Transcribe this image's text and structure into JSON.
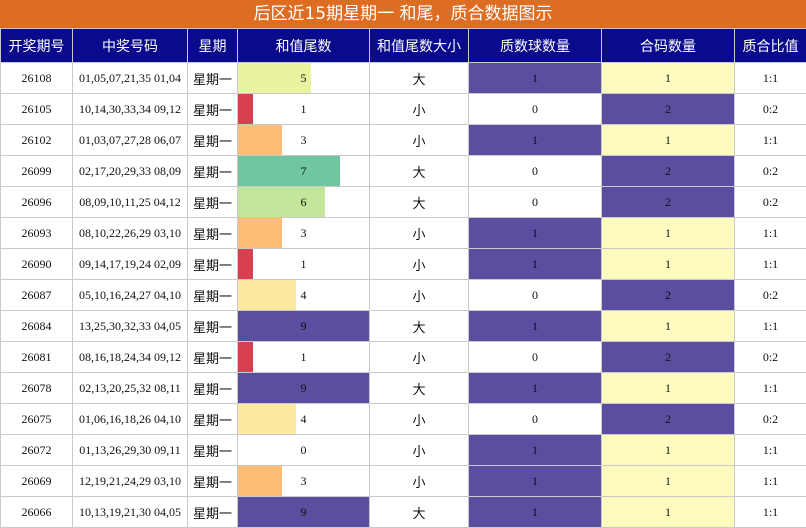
{
  "title": "后区近15期星期一 和尾，质合数据图示",
  "headers": [
    "开奖期号",
    "中奖号码",
    "星期",
    "和值尾数",
    "和值尾数大小",
    "质数球数量",
    "合码数量",
    "质合比值"
  ],
  "colors": {
    "title_bg": "#de6d24",
    "header_bg": "#0a0a8c",
    "purple": "#5b4da0",
    "light_yellow": "#fefbbf",
    "tail_colors": {
      "0": "#ffffff",
      "1": "#d9404f",
      "3": "#fdbd74",
      "4": "#fde9a0",
      "5": "#eaf4a0",
      "6": "#c3e69a",
      "7": "#6fc69f",
      "9": "#5b4da0"
    }
  },
  "rows": [
    {
      "issue": "26108",
      "numbers": "01,05,07,21,35 01,04",
      "weekday": "星期一",
      "tail": 5,
      "size": "大",
      "prime_count": 1,
      "composite_count": 1,
      "ratio": "1:1"
    },
    {
      "issue": "26105",
      "numbers": "10,14,30,33,34 09,12",
      "weekday": "星期一",
      "tail": 1,
      "size": "小",
      "prime_count": 0,
      "composite_count": 2,
      "ratio": "0:2"
    },
    {
      "issue": "26102",
      "numbers": "01,03,07,27,28 06,07",
      "weekday": "星期一",
      "tail": 3,
      "size": "小",
      "prime_count": 1,
      "composite_count": 1,
      "ratio": "1:1"
    },
    {
      "issue": "26099",
      "numbers": "02,17,20,29,33 08,09",
      "weekday": "星期一",
      "tail": 7,
      "size": "大",
      "prime_count": 0,
      "composite_count": 2,
      "ratio": "0:2"
    },
    {
      "issue": "26096",
      "numbers": "08,09,10,11,25 04,12",
      "weekday": "星期一",
      "tail": 6,
      "size": "大",
      "prime_count": 0,
      "composite_count": 2,
      "ratio": "0:2"
    },
    {
      "issue": "26093",
      "numbers": "08,10,22,26,29 03,10",
      "weekday": "星期一",
      "tail": 3,
      "size": "小",
      "prime_count": 1,
      "composite_count": 1,
      "ratio": "1:1"
    },
    {
      "issue": "26090",
      "numbers": "09,14,17,19,24 02,09",
      "weekday": "星期一",
      "tail": 1,
      "size": "小",
      "prime_count": 1,
      "composite_count": 1,
      "ratio": "1:1"
    },
    {
      "issue": "26087",
      "numbers": "05,10,16,24,27 04,10",
      "weekday": "星期一",
      "tail": 4,
      "size": "小",
      "prime_count": 0,
      "composite_count": 2,
      "ratio": "0:2"
    },
    {
      "issue": "26084",
      "numbers": "13,25,30,32,33 04,05",
      "weekday": "星期一",
      "tail": 9,
      "size": "大",
      "prime_count": 1,
      "composite_count": 1,
      "ratio": "1:1"
    },
    {
      "issue": "26081",
      "numbers": "08,16,18,24,34 09,12",
      "weekday": "星期一",
      "tail": 1,
      "size": "小",
      "prime_count": 0,
      "composite_count": 2,
      "ratio": "0:2"
    },
    {
      "issue": "26078",
      "numbers": "02,13,20,25,32 08,11",
      "weekday": "星期一",
      "tail": 9,
      "size": "大",
      "prime_count": 1,
      "composite_count": 1,
      "ratio": "1:1"
    },
    {
      "issue": "26075",
      "numbers": "01,06,16,18,26 04,10",
      "weekday": "星期一",
      "tail": 4,
      "size": "小",
      "prime_count": 0,
      "composite_count": 2,
      "ratio": "0:2"
    },
    {
      "issue": "26072",
      "numbers": "01,13,26,29,30 09,11",
      "weekday": "星期一",
      "tail": 0,
      "size": "小",
      "prime_count": 1,
      "composite_count": 1,
      "ratio": "1:1"
    },
    {
      "issue": "26069",
      "numbers": "12,19,21,24,29 03,10",
      "weekday": "星期一",
      "tail": 3,
      "size": "小",
      "prime_count": 1,
      "composite_count": 1,
      "ratio": "1:1"
    },
    {
      "issue": "26066",
      "numbers": "10,13,19,21,30 04,05",
      "weekday": "星期一",
      "tail": 9,
      "size": "大",
      "prime_count": 1,
      "composite_count": 1,
      "ratio": "1:1"
    }
  ]
}
